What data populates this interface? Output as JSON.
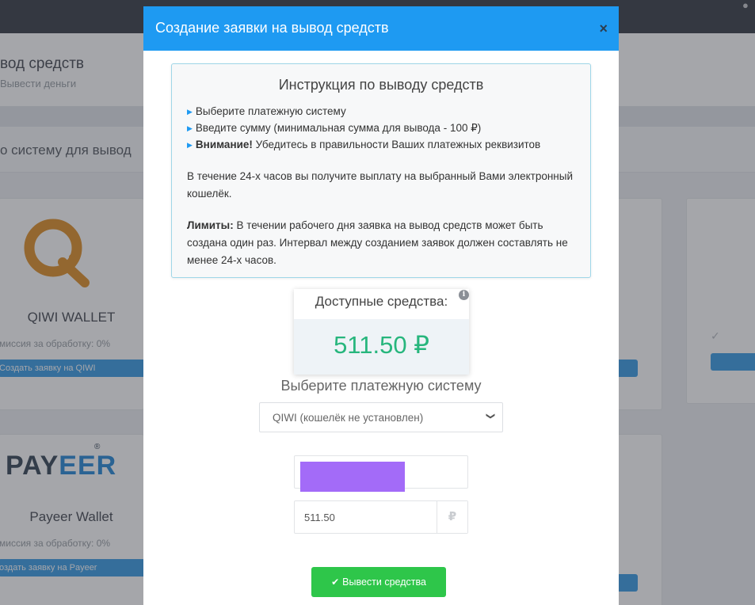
{
  "background": {
    "page_title": "вод средств",
    "page_subtitle": "Вывести деньги",
    "section_title": "о систему для вывод",
    "cards": [
      {
        "name": "QIWI WALLET",
        "fee": "миссия за обработку: 0%",
        "button": "Создать заявку на QIWI"
      },
      {
        "name": "Payeer Wallet",
        "fee": "миссия за обработку: 0%",
        "button": "оздать заявку на Payeer"
      }
    ],
    "payeer_logo": {
      "pay": "PAY",
      "eer": "EER",
      "reg": "®"
    },
    "check_glyph": "✓",
    "user_icon": "user-icon"
  },
  "modal": {
    "title": "Создание заявки на вывод средств",
    "close_glyph": "×",
    "instructions": {
      "title": "Инструкция по выводу средств",
      "items": [
        {
          "bold": "",
          "text": "Выберите платежную систему"
        },
        {
          "bold": "",
          "text": "Введите сумму (минимальная сумма для вывода - 100 ₽)"
        },
        {
          "bold": "Внимание!",
          "text": " Убедитесь в правильности Ваших платежных реквизитов"
        }
      ],
      "payout_note": "В течение 24-х часов вы получите выплату на выбранный Вами электронный кошелёк.",
      "limits_label": "Лимиты:",
      "limits_text": " В течении рабочего дня заявка на вывод средств может быть создана один раз. Интервал между созданием заявок должен составлять не менее 24-х часов."
    },
    "balance": {
      "label": "Доступные средства:",
      "info_glyph": "i",
      "value": "511.50 ₽"
    },
    "payment_system": {
      "label": "Выберите платежную систему",
      "selected": "QIWI (кошелёк не установлен)",
      "arrow_glyph": "⌄"
    },
    "amount": {
      "value": "511.50",
      "currency": "₽"
    },
    "submit": {
      "check_glyph": "✔",
      "label": "Вывести средства"
    }
  }
}
